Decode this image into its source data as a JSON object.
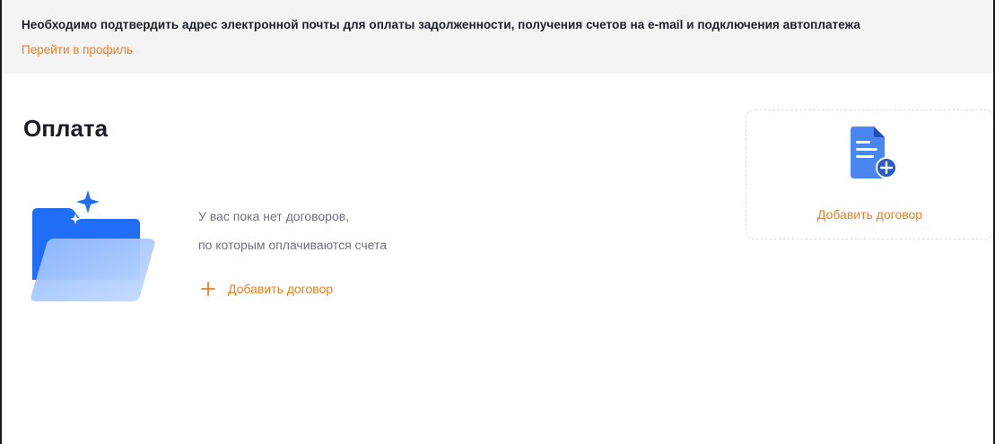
{
  "notice": {
    "text": "Необходимо подтвердить адрес электронной почты для оплаты задолженности, получения счетов на e-mail и подключения автоплатежа",
    "link_label": "Перейти в профиль"
  },
  "page": {
    "title": "Оплата"
  },
  "empty_state": {
    "line1": "У вас пока нет договоров,",
    "line2": "по которым оплачиваются счета",
    "add_label": "Добавить договор"
  },
  "add_card": {
    "label": "Добавить договор"
  },
  "colors": {
    "accent": "#f07d1f",
    "folder_blue": "#1f6ef5",
    "doc_blue": "#4a86f0",
    "notice_bg": "#f4f4f4"
  },
  "icons": {
    "folder": "folder-illustration-icon",
    "plus": "plus-icon",
    "document_add": "document-add-icon"
  }
}
